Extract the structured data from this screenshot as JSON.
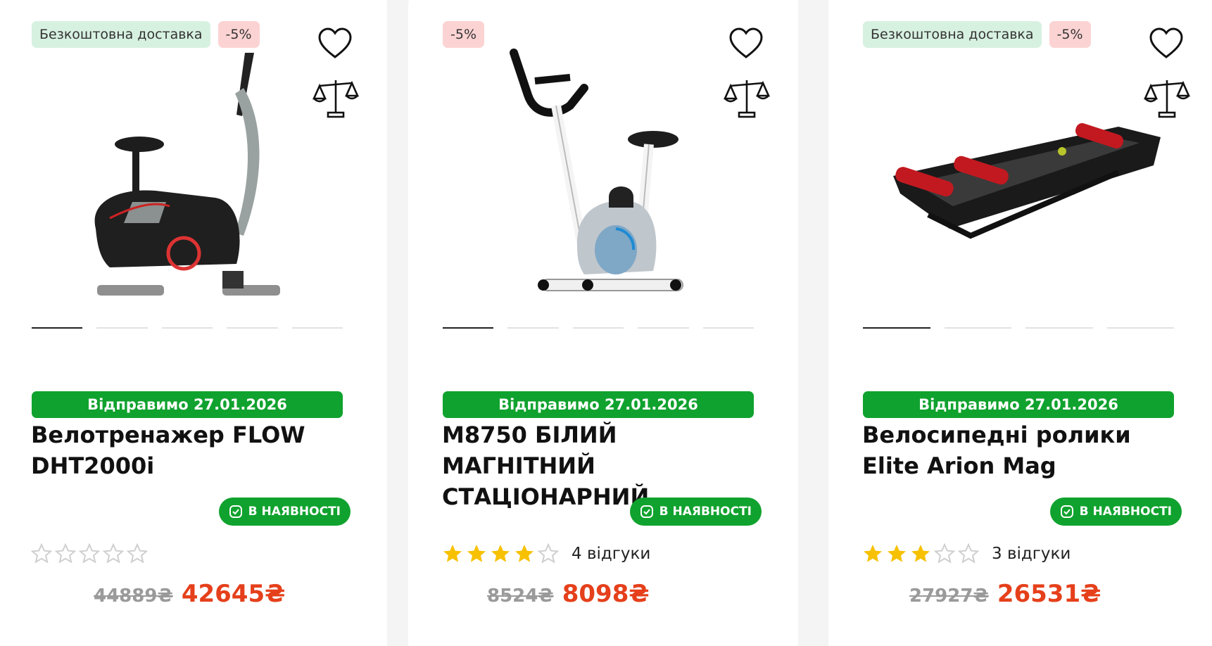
{
  "products": [
    {
      "badges": {
        "delivery": "Безкоштовна доставка",
        "discount": "-5%"
      },
      "ship_label": "Відправимо 27.01.2026",
      "title": " Велотренажер FLOW DHT2000i",
      "stock_label": "В НАЯВНОСТІ",
      "rating": 0,
      "reviews_label": "",
      "old_price": "44889₴",
      "new_price": "42645₴",
      "image_icon": "exercise-bike-black-image"
    },
    {
      "badges": {
        "delivery": "",
        "discount": "-5%"
      },
      "ship_label": "Відправимо 27.01.2026",
      "title": "M8750 БІЛИЙ МАГНІТНИЙ СТАЦІОНАРНИЙ...",
      "stock_label": "В НАЯВНОСТІ",
      "rating": 4,
      "reviews_label": "4 відгуки",
      "old_price": "8524₴",
      "new_price": "8098₴",
      "image_icon": "exercise-bike-white-image"
    },
    {
      "badges": {
        "delivery": "Безкоштовна доставка",
        "discount": "-5%"
      },
      "ship_label": "Відправимо 27.01.2026",
      "title": "Велосипедні ролики Elite Arion Mag",
      "stock_label": "В НАЯВНОСТІ",
      "rating": 3,
      "reviews_label": "3 відгуки",
      "old_price": "27927₴",
      "new_price": "26531₴",
      "image_icon": "bike-rollers-image"
    }
  ],
  "colors": {
    "ship_bar": "#10a22e",
    "price_new": "#e5401b",
    "price_old": "#9a9a9a",
    "star_filled": "#f7c100",
    "star_empty": "#cfcfcf"
  },
  "icons": [
    "heart-icon",
    "scales-icon",
    "check-icon",
    "star-icon"
  ]
}
